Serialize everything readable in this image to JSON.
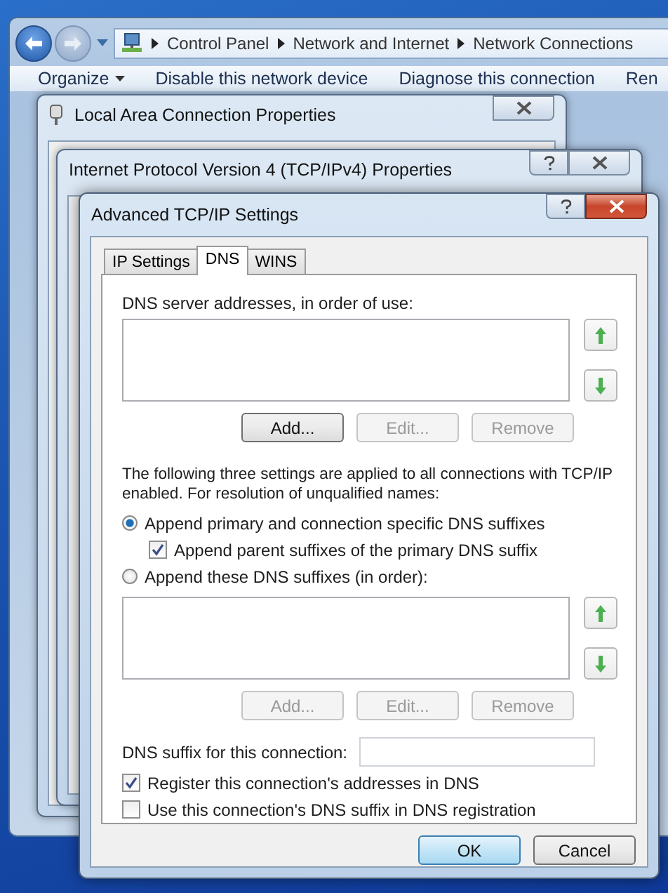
{
  "explorer": {
    "breadcrumb": [
      "Control Panel",
      "Network and Internet",
      "Network Connections"
    ],
    "toolbar": [
      {
        "label": "Organize",
        "menu": true
      },
      {
        "label": "Disable this network device",
        "menu": false
      },
      {
        "label": "Diagnose this connection",
        "menu": false
      },
      {
        "label": "Ren",
        "menu": false
      }
    ]
  },
  "windows": [
    {
      "title": "Local Area Connection Properties",
      "help": false
    },
    {
      "title": "Internet Protocol Version 4 (TCP/IPv4) Properties",
      "help": true
    }
  ],
  "dialog": {
    "title": "Advanced TCP/IP Settings",
    "tabs": [
      {
        "label": "IP Settings",
        "selected": false
      },
      {
        "label": "DNS",
        "selected": true
      },
      {
        "label": "WINS",
        "selected": false
      }
    ],
    "server_label": "DNS server addresses, in order of use:",
    "server_buttons": [
      {
        "label": "Add...",
        "disabled": false
      },
      {
        "label": "Edit...",
        "disabled": true
      },
      {
        "label": "Remove",
        "disabled": true
      }
    ],
    "note": "The following three settings are applied to all connections with TCP/IP enabled. For resolution of unqualified names:",
    "options": [
      {
        "kind": "radio",
        "label": "Append primary and connection specific DNS suffixes",
        "checked": true,
        "children": [
          {
            "kind": "checkbox",
            "label": "Append parent suffixes of the primary DNS suffix",
            "checked": true
          }
        ]
      },
      {
        "kind": "radio",
        "label": "Append these DNS suffixes (in order):",
        "checked": false
      }
    ],
    "suffix_buttons": [
      {
        "label": "Add...",
        "disabled": true
      },
      {
        "label": "Edit...",
        "disabled": true
      },
      {
        "label": "Remove",
        "disabled": true
      }
    ],
    "suffix_field": {
      "label": "DNS suffix for this connection:"
    },
    "registration": [
      {
        "kind": "checkbox",
        "label": "Register this connection's addresses in DNS",
        "checked": true
      },
      {
        "kind": "checkbox",
        "label": "Use this connection's DNS suffix in DNS registration",
        "checked": false
      }
    ],
    "buttons": [
      {
        "label": "OK",
        "default": true
      },
      {
        "label": "Cancel",
        "default": false
      }
    ]
  }
}
